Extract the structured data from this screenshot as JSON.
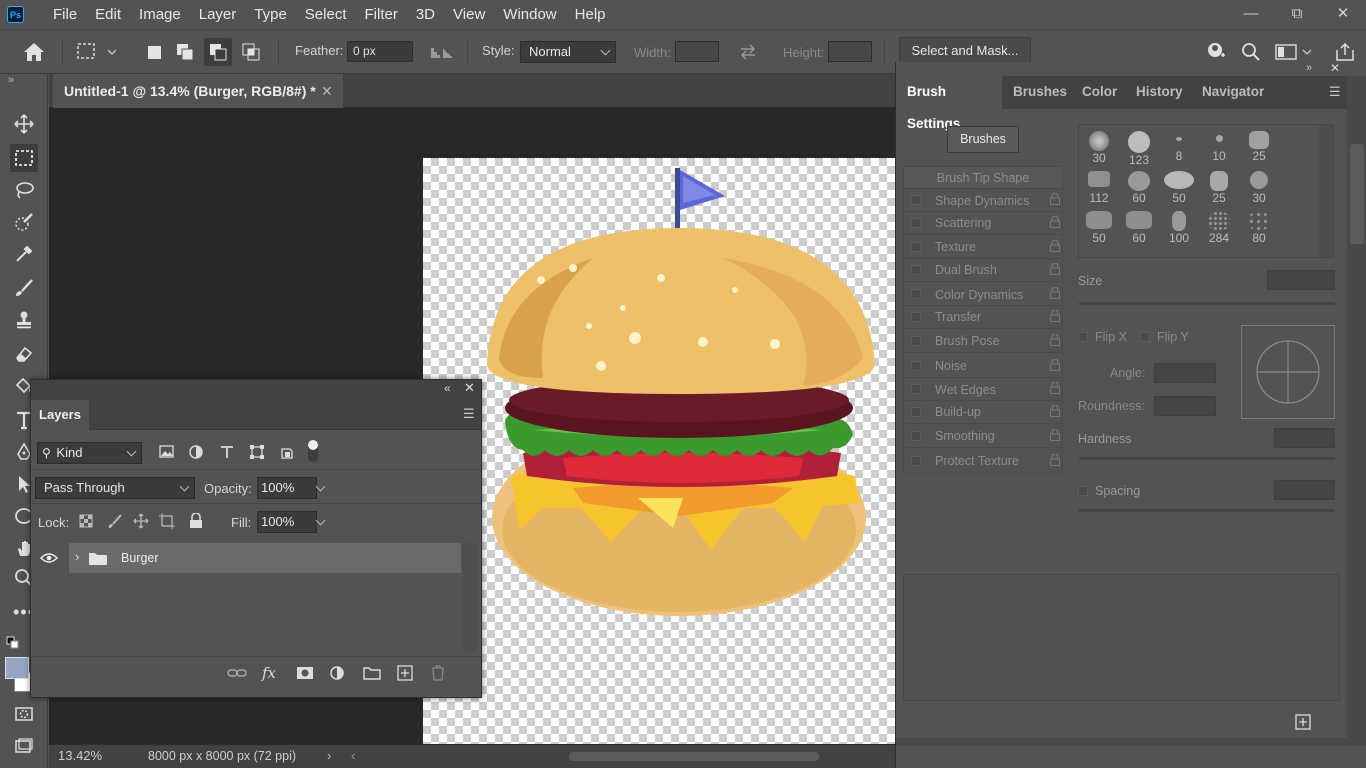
{
  "app": {
    "logo": "Ps"
  },
  "menu": [
    "File",
    "Edit",
    "Image",
    "Layer",
    "Type",
    "Select",
    "Filter",
    "3D",
    "View",
    "Window",
    "Help"
  ],
  "window_controls": [
    "minimize-icon",
    "restore-icon",
    "close-icon"
  ],
  "options_bar": {
    "feather_label": "Feather:",
    "feather_value": "0 px",
    "style_label": "Style:",
    "style_value": "Normal",
    "width_label": "Width:",
    "height_label": "Height:",
    "select_mask": "Select and Mask..."
  },
  "document": {
    "tab_title": "Untitled-1 @ 13.4% (Burger, RGB/8#) *",
    "zoom": "13.42%",
    "dimensions": "8000 px x 8000 px (72 ppi)"
  },
  "layers_panel": {
    "tab": "Layers",
    "filter_kind": "Kind",
    "blend_mode": "Pass Through",
    "opacity_label": "Opacity:",
    "opacity_value": "100%",
    "lock_label": "Lock:",
    "fill_label": "Fill:",
    "fill_value": "100%",
    "layers": [
      {
        "name": "Burger",
        "type": "group",
        "visible": true
      }
    ]
  },
  "right_panel": {
    "tabs": [
      "Brush Settings",
      "Brushes",
      "Color",
      "History",
      "Navigator"
    ],
    "active_tab": "Brush Settings",
    "brushes_button": "Brushes",
    "settings": [
      "Brush Tip Shape",
      "Shape Dynamics",
      "Scattering",
      "Texture",
      "Dual Brush",
      "Color Dynamics",
      "Transfer",
      "Brush Pose",
      "Noise",
      "Wet Edges",
      "Build-up",
      "Smoothing",
      "Protect Texture"
    ],
    "brush_sizes": [
      "30",
      "123",
      "8",
      "10",
      "25",
      "112",
      "60",
      "50",
      "25",
      "30",
      "50",
      "60",
      "100",
      "284",
      "80"
    ],
    "size_label": "Size",
    "flip_x": "Flip X",
    "flip_y": "Flip Y",
    "angle_label": "Angle:",
    "roundness_label": "Roundness:",
    "hardness_label": "Hardness",
    "spacing_label": "Spacing"
  },
  "colors": {
    "accent": "#31a8ff",
    "flag": "#5b67d6"
  }
}
